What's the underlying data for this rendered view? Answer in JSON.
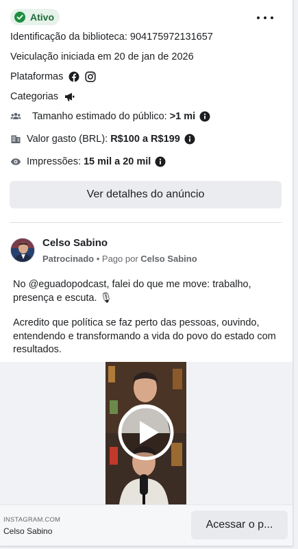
{
  "ad": {
    "status": "Ativo",
    "library_id_label": "Identificação da biblioteca: ",
    "library_id": "904175972131657",
    "start_text": "Veiculação iniciada em 20 de jan de 2026",
    "platforms_label": "Plataformas",
    "platform_icons": [
      "facebook-icon",
      "instagram-icon"
    ],
    "categories_label": "Categorias",
    "category_icon": "megaphone-icon",
    "audience_label": "Tamanho estimado do público: ",
    "audience_value": ">1 mi",
    "spend_label": "Valor gasto (BRL): ",
    "spend_value": "R$100 a R$199",
    "impressions_label": "Impressões: ",
    "impressions_value": "15 mil a 20 mil",
    "details_button": "Ver detalhes do anúncio"
  },
  "post": {
    "advertiser": "Celso Sabino",
    "sponsored": "Patrocinado",
    "paid_by_prefix": " • Pago por ",
    "paid_by": "Celso Sabino",
    "paragraph1": "No @eguadopodcast, falei do que me move: trabalho, presença e escuta. 🎙",
    "paragraph2": "Acredito que política se faz perto das pessoas, ouvindo, entendendo e transformando a vida do povo do estado com resultados."
  },
  "footer": {
    "domain": "INSTAGRAM.COM",
    "name": "Celso Sabino",
    "cta": "Acessar o p..."
  },
  "colors": {
    "active_badge_bg": "#e6f2ea",
    "active_badge_text": "#1e6b3a",
    "button_bg": "#eaecef"
  }
}
